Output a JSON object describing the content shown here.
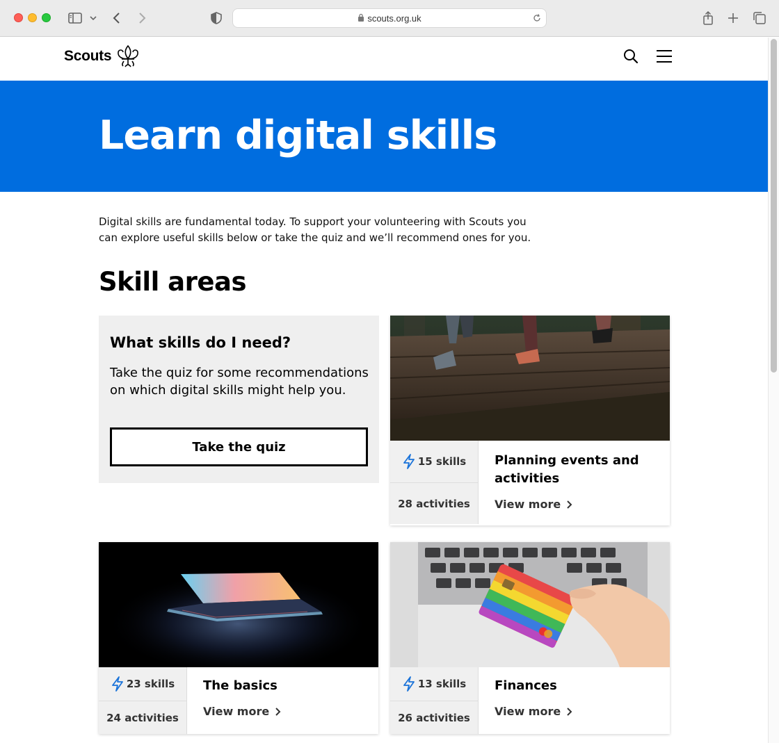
{
  "browser": {
    "url": "scouts.org.uk"
  },
  "site": {
    "logo_text": "Scouts"
  },
  "hero": {
    "title": "Learn digital skills"
  },
  "intro": " Digital skills are fundamental today. To support your volunteering with Scouts you can explore useful skills below or take the quiz and we’ll recommend ones for you.",
  "section_title": "Skill areas",
  "quiz": {
    "heading": "What skills do I need?",
    "text": "Take the quiz for some recommendations on which digital skills might help you.",
    "button": "Take the quiz"
  },
  "cards": [
    {
      "skills": "15 skills",
      "activities": "28 activities",
      "title": "Planning events and activities",
      "view": "View more"
    },
    {
      "skills": "23 skills",
      "activities": "24 activities",
      "title": "The basics",
      "view": "View more"
    },
    {
      "skills": "13 skills",
      "activities": "26 activities",
      "title": "Finances",
      "view": "View more"
    }
  ],
  "colors": {
    "hero": "#006ddf",
    "quiz_bg": "#efefef",
    "bolt_icon": "#1a73d9"
  }
}
